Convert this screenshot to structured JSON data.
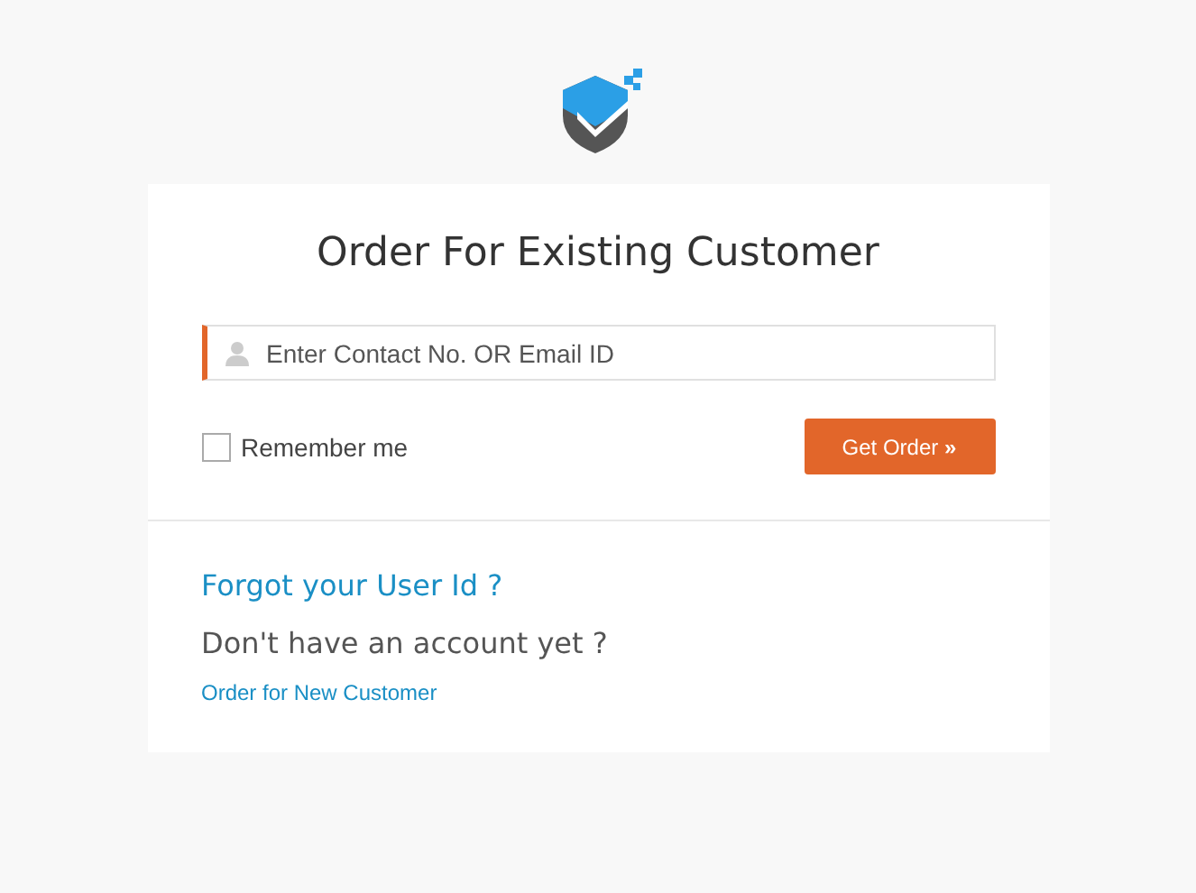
{
  "title": "Order For Existing Customer",
  "contact_field": {
    "placeholder": "Enter Contact No. OR Email ID"
  },
  "remember_me": {
    "label": "Remember me",
    "checked": false
  },
  "submit_button": {
    "label": "Get Order",
    "glyph": "»"
  },
  "forgot_link": "Forgot your User Id ?",
  "no_account_text": "Don't have an account yet ?",
  "new_customer_link": "Order for New Customer"
}
